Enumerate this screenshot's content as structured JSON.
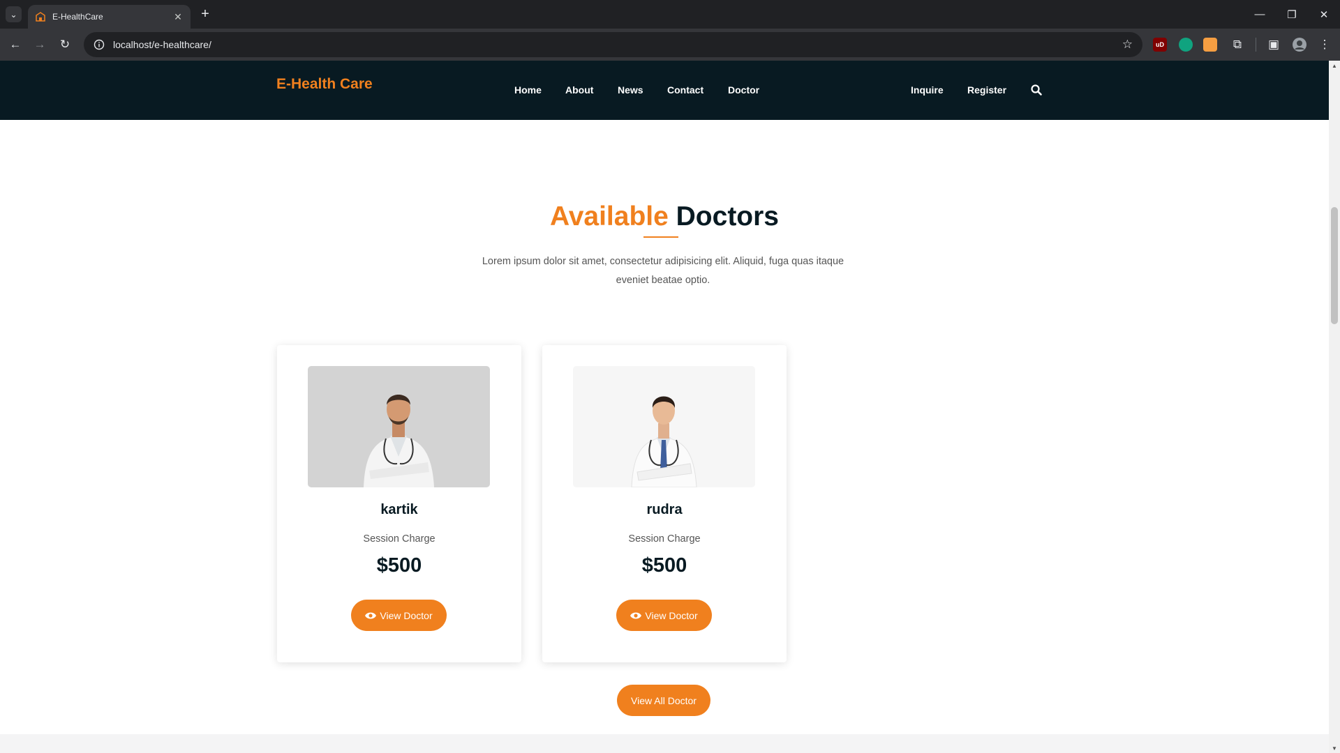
{
  "browser": {
    "tab_title": "E-HealthCare",
    "url": "localhost/e-healthcare/",
    "extensions": [
      {
        "name": "ublock-icon",
        "label": "uD",
        "color": "#800000"
      },
      {
        "name": "chatgpt-icon",
        "label": "",
        "color": "#10a37f"
      },
      {
        "name": "extension-orange-icon",
        "label": "",
        "color": "#f59e42"
      }
    ]
  },
  "site": {
    "logo": "E-Health Care",
    "nav": {
      "home": "Home",
      "about": "About",
      "news": "News",
      "contact": "Contact",
      "doctor": "Doctor",
      "inquire": "Inquire",
      "register": "Register"
    }
  },
  "section": {
    "title_accent": "Available",
    "title_rest": "Doctors",
    "intro": "Lorem ipsum dolor sit amet, consectetur adipisicing elit. Aliquid, fuga quas itaque eveniet beatae optio."
  },
  "doctors": [
    {
      "name": "kartik",
      "charge_label": "Session Charge",
      "price": "$500",
      "button": "View Doctor",
      "photo_bg": "#d3d3d3"
    },
    {
      "name": "rudra",
      "charge_label": "Session Charge",
      "price": "$500",
      "button": "View Doctor",
      "photo_bg": "#f6f6f6"
    }
  ],
  "view_all_label": "View All Doctor",
  "colors": {
    "accent": "#f0801e",
    "nav_bg": "#081a22"
  }
}
